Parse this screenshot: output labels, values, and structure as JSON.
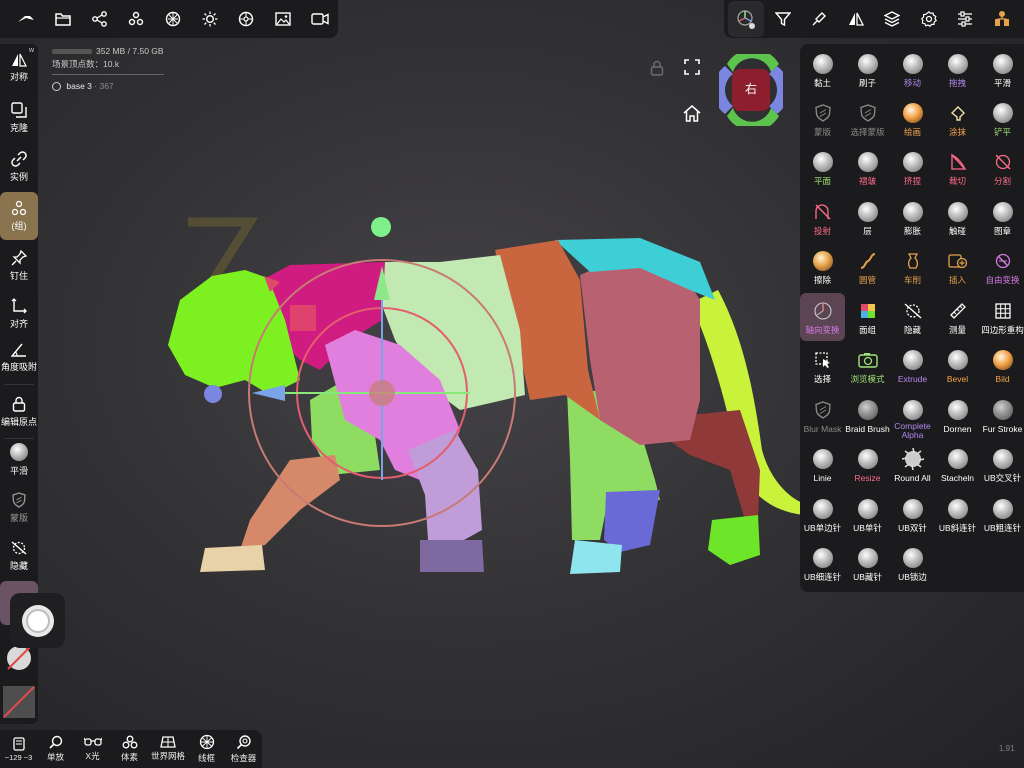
{
  "top_left_toolbar": [
    {
      "name": "wand-icon"
    },
    {
      "name": "folder-icon"
    },
    {
      "name": "share-icon"
    },
    {
      "name": "scene-icon"
    },
    {
      "name": "material-icon"
    },
    {
      "name": "light-icon"
    },
    {
      "name": "render-icon"
    },
    {
      "name": "image-icon"
    },
    {
      "name": "video-icon"
    }
  ],
  "top_right_toolbar": [
    {
      "name": "gizmo-settings-icon"
    },
    {
      "name": "filter-icon"
    },
    {
      "name": "stroke-icon"
    },
    {
      "name": "symmetry-icon"
    },
    {
      "name": "layers-icon"
    },
    {
      "name": "settings-icon"
    },
    {
      "name": "sliders-icon"
    },
    {
      "name": "scene-tree-icon"
    }
  ],
  "info": {
    "memory": "352 MB / 7.50 GB",
    "vertices": "场景顶点数：10.k",
    "object_name": "base 3",
    "object_count": "· 367"
  },
  "left_sidebar": [
    {
      "label": "对称",
      "icon": "symmetry-icon",
      "badge": "w"
    },
    {
      "label": "克隆",
      "icon": "clone-icon"
    },
    {
      "label": "实例",
      "icon": "link-icon"
    },
    {
      "label": "(组)",
      "icon": "group-icon",
      "active": true
    },
    {
      "label": "钉住",
      "icon": "pin-icon"
    },
    {
      "label": "对齐",
      "icon": "align-icon"
    },
    {
      "label": "角度吸附",
      "icon": "angle-icon"
    },
    {
      "label": "编辑原点",
      "icon": "lock-icon"
    },
    {
      "label": "平滑",
      "icon": "smooth-sphere-icon"
    },
    {
      "label": "蒙版",
      "icon": "mask-icon"
    },
    {
      "label": "隐藏",
      "icon": "hide-icon"
    }
  ],
  "brush_panel": [
    {
      "label": "黏土",
      "color": "#ffffff",
      "icon": "sphere"
    },
    {
      "label": "刷子",
      "color": "#ffffff",
      "icon": "sphere"
    },
    {
      "label": "移动",
      "color": "#b389f0",
      "icon": "sphere"
    },
    {
      "label": "拖拽",
      "color": "#b389f0",
      "icon": "sphere"
    },
    {
      "label": "平滑",
      "color": "#ffffff",
      "icon": "sphere"
    },
    {
      "label": "蒙版",
      "color": "#8a8a8a",
      "icon": "mask"
    },
    {
      "label": "选择蒙版",
      "color": "#8a8a8a",
      "icon": "mask"
    },
    {
      "label": "绘画",
      "color": "#f3a34a",
      "icon": "orange"
    },
    {
      "label": "涂抹",
      "color": "#f3a34a",
      "icon": "smudge"
    },
    {
      "label": "铲平",
      "color": "#9fe37a",
      "icon": "sphere"
    },
    {
      "label": "平面",
      "color": "#9fe37a",
      "icon": "sphere"
    },
    {
      "label": "褶皱",
      "color": "#ff6b8a",
      "icon": "sphere"
    },
    {
      "label": "挤捏",
      "color": "#ff6b8a",
      "icon": "sphere"
    },
    {
      "label": "裁切",
      "color": "#ff6b8a",
      "icon": "cut"
    },
    {
      "label": "分割",
      "color": "#ff6b8a",
      "icon": "split"
    },
    {
      "label": "投射",
      "color": "#ff6b8a",
      "icon": "project"
    },
    {
      "label": "层",
      "color": "#ffffff",
      "icon": "sphere"
    },
    {
      "label": "膨胀",
      "color": "#ffffff",
      "icon": "sphere"
    },
    {
      "label": "触碰",
      "color": "#ffffff",
      "icon": "sphere"
    },
    {
      "label": "图章",
      "color": "#ffffff",
      "icon": "sphere"
    },
    {
      "label": "擦除",
      "color": "#ffffff",
      "icon": "gold"
    },
    {
      "label": "圆管",
      "color": "#e5a24a",
      "icon": "tube"
    },
    {
      "label": "车削",
      "color": "#e5a24a",
      "icon": "lathe"
    },
    {
      "label": "插入",
      "color": "#e5a24a",
      "icon": "insert"
    },
    {
      "label": "自由变换",
      "color": "#d678e8",
      "icon": "transform"
    },
    {
      "label": "轴向变换",
      "color": "#d678e8",
      "icon": "axis",
      "selected": true
    },
    {
      "label": "面组",
      "color": "#ffffff",
      "icon": "facegroup"
    },
    {
      "label": "隐藏",
      "color": "#ffffff",
      "icon": "hide"
    },
    {
      "label": "测量",
      "color": "#ffffff",
      "icon": "measure"
    },
    {
      "label": "四边形重构",
      "color": "#ffffff",
      "icon": "quad"
    },
    {
      "label": "选择",
      "color": "#ffffff",
      "icon": "select"
    },
    {
      "label": "浏览模式",
      "color": "#9fe37a",
      "icon": "camera"
    },
    {
      "label": "Extrude",
      "color": "#b389f0",
      "icon": "sphere"
    },
    {
      "label": "Bevel",
      "color": "#f3a34a",
      "icon": "sphere"
    },
    {
      "label": "Bild",
      "color": "#f3a34a",
      "icon": "orange"
    },
    {
      "label": "Blur Mask",
      "color": "#8a8a8a",
      "icon": "mask"
    },
    {
      "label": "Braid Brush",
      "color": "#ffffff",
      "icon": "dim"
    },
    {
      "label": "Complete Alpha",
      "color": "#b389f0",
      "icon": "sphere"
    },
    {
      "label": "Dornen",
      "color": "#ffffff",
      "icon": "sphere"
    },
    {
      "label": "Fur Stroke",
      "color": "#ffffff",
      "icon": "dim"
    },
    {
      "label": "Linie",
      "color": "#ffffff",
      "icon": "sphere"
    },
    {
      "label": "Resize",
      "color": "#ff6b8a",
      "icon": "sphere"
    },
    {
      "label": "Round All",
      "color": "#ffffff",
      "icon": "spiky"
    },
    {
      "label": "Stacheln",
      "color": "#ffffff",
      "icon": "sphere"
    },
    {
      "label": "UB交叉针",
      "color": "#ffffff",
      "icon": "sphere"
    },
    {
      "label": "UB单边针",
      "color": "#ffffff",
      "icon": "sphere"
    },
    {
      "label": "UB单针",
      "color": "#ffffff",
      "icon": "sphere"
    },
    {
      "label": "UB双针",
      "color": "#ffffff",
      "icon": "sphere"
    },
    {
      "label": "UB斜连针",
      "color": "#ffffff",
      "icon": "sphere"
    },
    {
      "label": "UB粗连针",
      "color": "#ffffff",
      "icon": "sphere"
    },
    {
      "label": "UB细连针",
      "color": "#ffffff",
      "icon": "sphere"
    },
    {
      "label": "UB藏针",
      "color": "#ffffff",
      "icon": "sphere"
    },
    {
      "label": "UB锁边",
      "color": "#ffffff",
      "icon": "sphere"
    }
  ],
  "bottom_toolbar": [
    {
      "label": "~129 ~3",
      "icon": "device-icon"
    },
    {
      "label": "单放",
      "icon": "zoom-icon"
    },
    {
      "label": "X光",
      "icon": "xray-icon"
    },
    {
      "label": "体素",
      "icon": "voxel-icon"
    },
    {
      "label": "世界网格",
      "icon": "grid-icon"
    },
    {
      "label": "线框",
      "icon": "wireframe-icon"
    },
    {
      "label": "检查器",
      "icon": "inspector-icon"
    }
  ],
  "view_cube": {
    "label": "右"
  },
  "version": "1.91"
}
